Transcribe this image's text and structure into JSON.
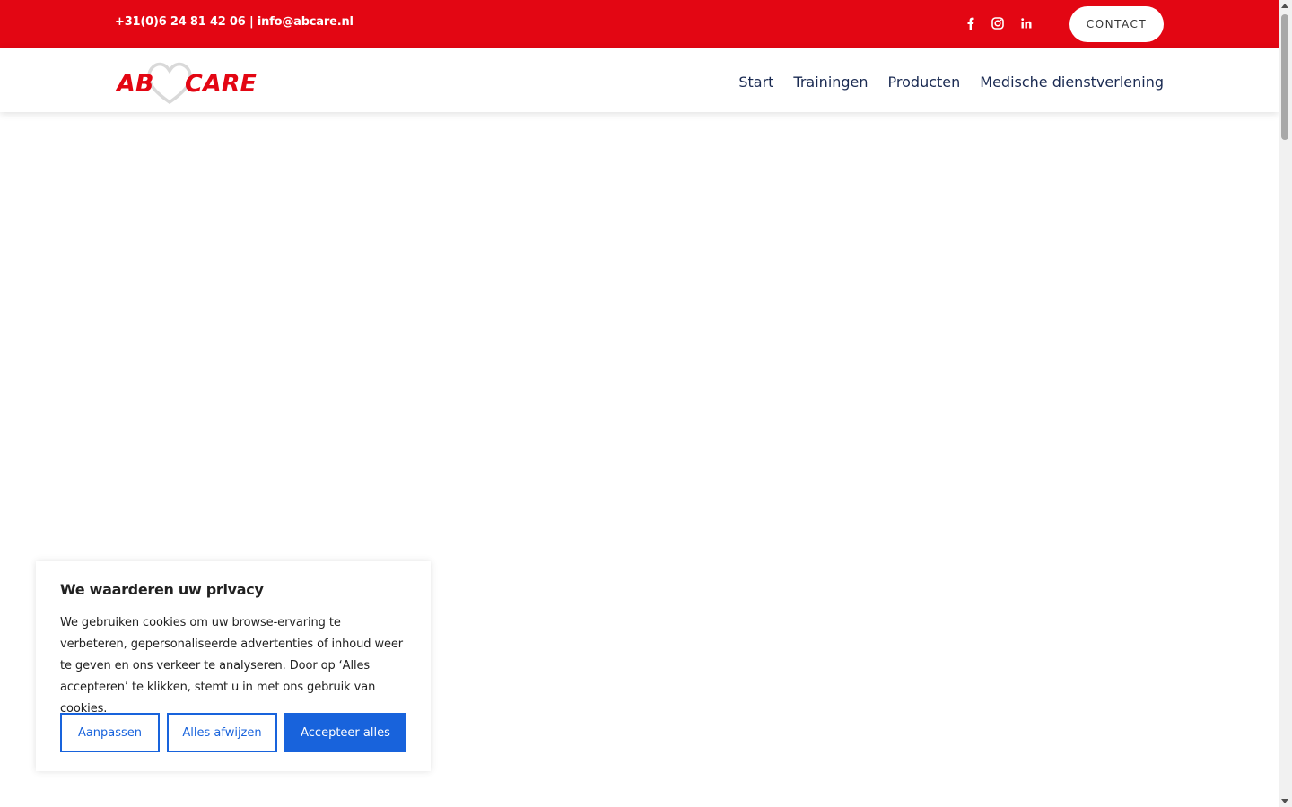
{
  "topbar": {
    "contact_info": "+31(0)6 24 81 42 06 | info@abcare.nl",
    "social_icons": [
      "facebook-icon",
      "instagram-icon",
      "linkedin-icon"
    ],
    "contact_label": "CONTACT",
    "background_color": "#e30613"
  },
  "header": {
    "logo": {
      "left_text": "AB",
      "right_text": "CARE",
      "color": "#e30613"
    },
    "nav": [
      "Start",
      "Trainingen",
      "Producten",
      "Medische dienstverlening"
    ]
  },
  "cookie_banner": {
    "title": "We waarderen uw privacy",
    "body": "We gebruiken cookies om uw browse-ervaring te verbeteren, gepersonaliseerde advertenties of inhoud weer te geven en ons verkeer te analyseren. Door op ‘Alles accepteren’ te klikken, stemt u in met ons gebruik van cookies.",
    "buttons": {
      "customize": "Aanpassen",
      "reject": "Alles afwijzen",
      "accept": "Accepteer alles"
    },
    "accent_color": "#1863dc"
  }
}
